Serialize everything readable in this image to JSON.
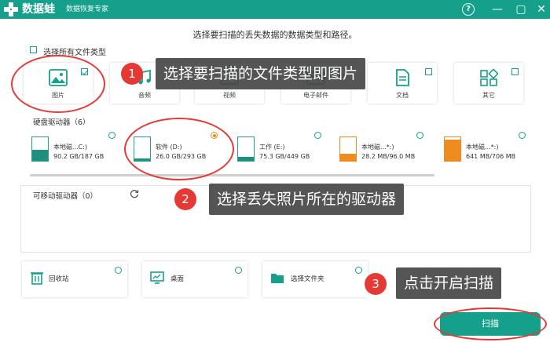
{
  "titlebar": {
    "app_name": "数据蛙",
    "app_subtitle": "数据恢复专家",
    "help_icon": "help-icon",
    "min_glyph": "—",
    "max_glyph": "▢",
    "close_glyph": "✕"
  },
  "headline": "选择要扫描的丢失数据的数据类型和路径。",
  "file_types": {
    "select_all_label": "选择所有文件类型",
    "items": [
      {
        "label": "图片",
        "icon": "image-icon",
        "checked": true
      },
      {
        "label": "音频",
        "icon": "audio-icon",
        "checked": false
      },
      {
        "label": "视频",
        "icon": "video-icon",
        "checked": false
      },
      {
        "label": "电子邮件",
        "icon": "email-icon",
        "checked": false
      },
      {
        "label": "文档",
        "icon": "document-icon",
        "checked": false
      },
      {
        "label": "其它",
        "icon": "other-icon",
        "checked": false
      }
    ]
  },
  "hard_drives": {
    "label": "硬盘驱动器（6）",
    "items": [
      {
        "name": "本地磁...C:)",
        "size": "90.2 GB/187 GB",
        "fill": 0.48,
        "color": "#1f8f80",
        "selected": false
      },
      {
        "name": "软件 (D:)",
        "size": "26.0 GB/293 GB",
        "fill": 0.09,
        "color": "#1f8f80",
        "selected": true
      },
      {
        "name": "工作 (E:)",
        "size": "75.3 GB/449 GB",
        "fill": 0.17,
        "color": "#1f8f80",
        "selected": false
      },
      {
        "name": "本地磁...*:)",
        "size": "28.2 MB/96.0 MB",
        "fill": 0.29,
        "color": "#ee8c1f",
        "selected": false
      },
      {
        "name": "本地磁...*:)",
        "size": "641 MB/706 MB",
        "fill": 0.91,
        "color": "#ee8c1f",
        "selected": false
      }
    ]
  },
  "removable_drives": {
    "label": "可移动驱动器（0）"
  },
  "locations": [
    {
      "label": "回收站",
      "icon": "recycle-bin-icon"
    },
    {
      "label": "桌面",
      "icon": "desktop-icon"
    },
    {
      "label": "选择文件夹",
      "icon": "folder-icon"
    }
  ],
  "scan_button": "扫描",
  "annotations": [
    {
      "num": "1",
      "text": "选择要扫描的文件类型即图片"
    },
    {
      "num": "2",
      "text": "选择丢失照片所在的驱动器"
    },
    {
      "num": "3",
      "text": "点击开启扫描"
    }
  ],
  "colors": {
    "accent": "#14a08a",
    "annotation_red": "#e53935",
    "drive_orange": "#ee8c1f"
  }
}
